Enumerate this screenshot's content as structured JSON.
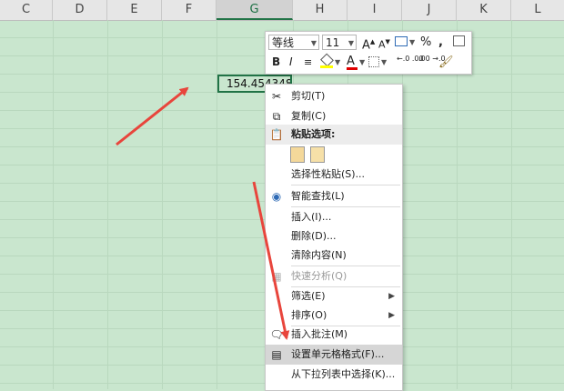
{
  "columns": [
    "C",
    "D",
    "E",
    "F",
    "G",
    "H",
    "I",
    "J",
    "K",
    "L"
  ],
  "selected_column": "G",
  "active_cell": {
    "value": "154.4543484"
  },
  "mini_toolbar": {
    "font_name": "等线",
    "font_size": "11",
    "percent_symbol": "%",
    "comma_symbol": ",",
    "bold": "B",
    "italic": "I",
    "font_color_letter": "A",
    "inc_decimal": "←.0 .00",
    "dec_decimal": ".00 →.0"
  },
  "context_menu": {
    "items": [
      {
        "label": "剪切(T)",
        "icon": "scissors-icon"
      },
      {
        "label": "复制(C)",
        "icon": "copy-icon"
      },
      {
        "label": "粘贴选项:",
        "icon": "paste-icon"
      },
      {
        "label": "选择性粘贴(S)...",
        "icon": ""
      },
      {
        "label": "智能查找(L)",
        "icon": "smart-lookup-icon"
      },
      {
        "label": "插入(I)...",
        "icon": ""
      },
      {
        "label": "删除(D)...",
        "icon": ""
      },
      {
        "label": "清除内容(N)",
        "icon": ""
      },
      {
        "label": "快速分析(Q)",
        "icon": "quick-analysis-icon"
      },
      {
        "label": "筛选(E)",
        "icon": ""
      },
      {
        "label": "排序(O)",
        "icon": ""
      },
      {
        "label": "插入批注(M)",
        "icon": "comment-icon"
      },
      {
        "label": "设置单元格格式(F)...",
        "icon": "format-cells-icon"
      },
      {
        "label": "从下拉列表中选择(K)...",
        "icon": ""
      }
    ]
  },
  "colors": {
    "grid_background": "#c9e6ce",
    "annotation_arrow": "#e8453c",
    "selection_border": "#217346"
  }
}
